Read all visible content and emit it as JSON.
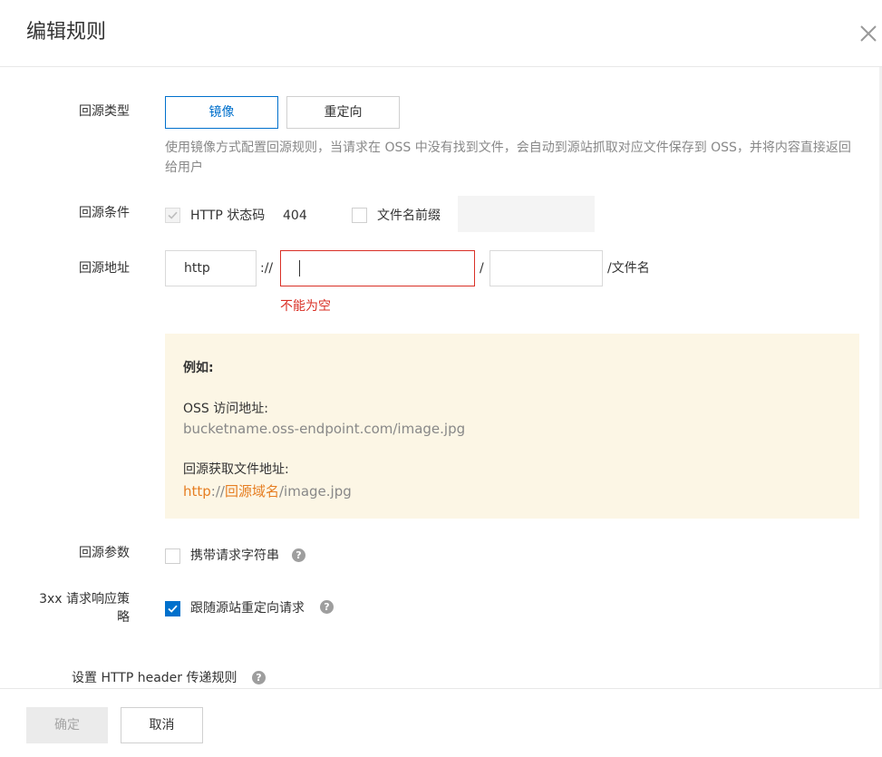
{
  "dialog": {
    "title": "编辑规则",
    "close_icon": "close-icon"
  },
  "origin_type": {
    "label": "回源类型",
    "options": [
      "镜像",
      "重定向"
    ],
    "selected": "镜像",
    "hint": "使用镜像方式配置回源规则，当请求在 OSS 中没有找到文件，会自动到源站抓取对应文件保存到 OSS，并将内容直接返回给用户"
  },
  "origin_condition": {
    "label": "回源条件",
    "http_status_label": "HTTP 状态码",
    "http_status_value": "404",
    "http_status_checked": true,
    "prefix_label": "文件名前缀",
    "prefix_checked": false,
    "prefix_value": ""
  },
  "origin_address": {
    "label": "回源地址",
    "protocol": "http",
    "separator": "://",
    "domain_value": "",
    "slash": "/",
    "path_value": "",
    "suffix": "/文件名",
    "error": "不能为空"
  },
  "example": {
    "title": "例如:",
    "oss_label": "OSS 访问地址:",
    "oss_value": "bucketname.oss-endpoint.com/image.jpg",
    "origin_label": "回源获取文件地址:",
    "origin_protocol": "http",
    "origin_sep": "://",
    "origin_domain": "回源域名",
    "origin_path": "/image.jpg"
  },
  "origin_params": {
    "label": "回源参数",
    "option": "携带请求字符串",
    "checked": false
  },
  "redirect_policy": {
    "label_line1": "3xx 请求响应策",
    "label_line2": "略",
    "option": "跟随源站重定向请求",
    "checked": true
  },
  "header_rule": {
    "label": "设置 HTTP header 传递规则"
  },
  "footer": {
    "ok": "确定",
    "cancel": "取消"
  },
  "colors": {
    "accent": "#0070cc",
    "error": "#d93026",
    "example_bg": "#fcf6e5",
    "orange": "#e67e22"
  }
}
